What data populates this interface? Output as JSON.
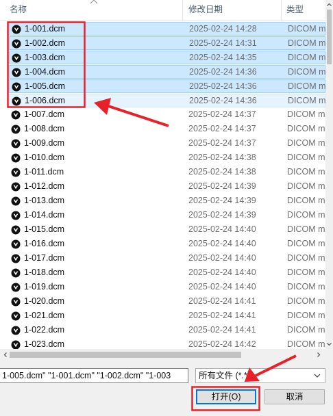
{
  "header": {
    "columns": [
      {
        "label": "名称"
      },
      {
        "label": "修改日期"
      },
      {
        "label": "类型"
      }
    ]
  },
  "files": [
    {
      "name": "1-001.dcm",
      "date": "2025-02-24 14:28",
      "type": "DICOM m",
      "state": "selected"
    },
    {
      "name": "1-002.dcm",
      "date": "2025-02-24 14:31",
      "type": "DICOM m",
      "state": "selected"
    },
    {
      "name": "1-003.dcm",
      "date": "2025-02-24 14:35",
      "type": "DICOM m",
      "state": "selected"
    },
    {
      "name": "1-004.dcm",
      "date": "2025-02-24 14:36",
      "type": "DICOM m",
      "state": "selected"
    },
    {
      "name": "1-005.dcm",
      "date": "2025-02-24 14:36",
      "type": "DICOM m",
      "state": "selected"
    },
    {
      "name": "1-006.dcm",
      "date": "2025-02-24 14:36",
      "type": "DICOM m",
      "state": "hover"
    },
    {
      "name": "1-007.dcm",
      "date": "2025-02-24 14:37",
      "type": "DICOM m",
      "state": "normal"
    },
    {
      "name": "1-008.dcm",
      "date": "2025-02-24 14:37",
      "type": "DICOM m",
      "state": "normal"
    },
    {
      "name": "1-009.dcm",
      "date": "2025-02-24 14:37",
      "type": "DICOM m",
      "state": "normal"
    },
    {
      "name": "1-010.dcm",
      "date": "2025-02-24 14:38",
      "type": "DICOM m",
      "state": "normal"
    },
    {
      "name": "1-011.dcm",
      "date": "2025-02-24 14:38",
      "type": "DICOM m",
      "state": "normal"
    },
    {
      "name": "1-012.dcm",
      "date": "2025-02-24 14:39",
      "type": "DICOM m",
      "state": "normal"
    },
    {
      "name": "1-013.dcm",
      "date": "2025-02-24 14:39",
      "type": "DICOM m",
      "state": "normal"
    },
    {
      "name": "1-014.dcm",
      "date": "2025-02-24 14:39",
      "type": "DICOM m",
      "state": "normal"
    },
    {
      "name": "1-015.dcm",
      "date": "2025-02-24 14:40",
      "type": "DICOM m",
      "state": "normal"
    },
    {
      "name": "1-016.dcm",
      "date": "2025-02-24 14:40",
      "type": "DICOM m",
      "state": "normal"
    },
    {
      "name": "1-017.dcm",
      "date": "2025-02-24 14:40",
      "type": "DICOM m",
      "state": "normal"
    },
    {
      "name": "1-018.dcm",
      "date": "2025-02-24 14:40",
      "type": "DICOM m",
      "state": "normal"
    },
    {
      "name": "1-019.dcm",
      "date": "2025-02-24 14:40",
      "type": "DICOM m",
      "state": "normal"
    },
    {
      "name": "1-020.dcm",
      "date": "2025-02-24 14:41",
      "type": "DICOM m",
      "state": "normal"
    },
    {
      "name": "1-021.dcm",
      "date": "2025-02-24 14:41",
      "type": "DICOM m",
      "state": "normal"
    },
    {
      "name": "1-022.dcm",
      "date": "2025-02-24 14:41",
      "type": "DICOM m",
      "state": "normal"
    },
    {
      "name": "1-023.dcm",
      "date": "2025-02-24 14:42",
      "type": "DICOM m",
      "state": "normal"
    }
  ],
  "file_icon": "dicom-viewer-icon",
  "filename_field": {
    "value": "1-005.dcm\" \"1-001.dcm\" \"1-002.dcm\" \"1-003"
  },
  "filetype_select": {
    "selected": "所有文件 (*.*)"
  },
  "buttons": {
    "open_label": "打开(O)",
    "cancel_label": "取消"
  },
  "colors": {
    "selection": "#cce8ff",
    "selection_border": "#99d1ff",
    "hover": "#e5f3ff",
    "annotation": "#e8202a",
    "focus_border": "#0078d7"
  }
}
